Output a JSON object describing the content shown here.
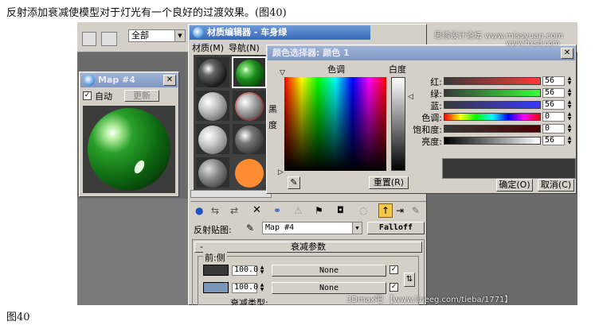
{
  "caption_top": "反射添加衰减使模型对于灯光有一个良好的过渡效果。(图40)",
  "caption_bottom": "图40",
  "watermarks": {
    "top_right": "思缘设计论坛 www.missyuan.com",
    "top_right2": "www.hxsd.com",
    "bottom_right": "3Dmax吧 【www.lineeg.com/tieba/1771】"
  },
  "toolbar_top": {
    "dropdown_value": "全部"
  },
  "map_window": {
    "title": "Map #4",
    "auto_label": "自动",
    "auto_checked": true,
    "update_label": "更新"
  },
  "material_editor": {
    "title": "材质编辑器 - 车身绿",
    "menu": [
      "材质(M)",
      "导航(N)"
    ],
    "reflection_map_label": "反射贴图:",
    "map_value": "Map #4",
    "map_type": "Falloff",
    "rollout_title": "衰减参数",
    "front_side_label": "前:侧",
    "row1_value": "100.0",
    "row2_value": "100.0",
    "row1_map": "None",
    "row2_map": "None",
    "falloff_type_label": "衰减类型:",
    "collapse_sign": "-"
  },
  "color_selector": {
    "title": "颜色选择器: 颜色 1",
    "hue_label": "色调",
    "whiteness_label": "白度",
    "black_label": "黑",
    "degree_label": "度",
    "channels": [
      {
        "label": "红:",
        "value": "56"
      },
      {
        "label": "绿:",
        "value": "56"
      },
      {
        "label": "蓝:",
        "value": "56"
      },
      {
        "label": "色调:",
        "value": "0"
      },
      {
        "label": "饱和度:",
        "value": "0"
      },
      {
        "label": "亮度:",
        "value": "56"
      }
    ],
    "reset_button": "重置(R)",
    "ok_button": "确定(O)",
    "cancel_button": "取消(C)",
    "preview_color": "#383838"
  }
}
